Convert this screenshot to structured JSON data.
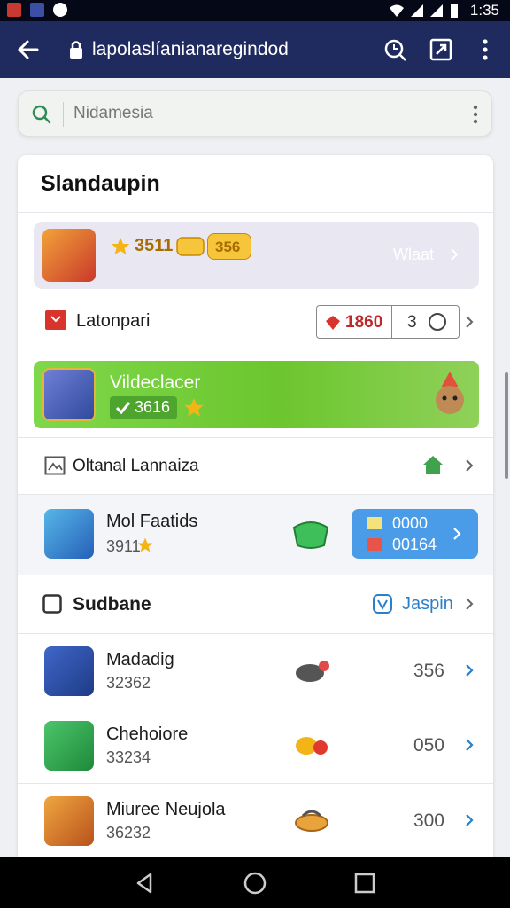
{
  "status_bar": {
    "time": "1:35"
  },
  "app_bar": {
    "url": "lapolaslíanianaregindod"
  },
  "search": {
    "placeholder": "Nidamesia"
  },
  "card": {
    "title": "Slandaupin",
    "featured": {
      "rating": "3511",
      "badge": "356",
      "action": "Wlaat"
    },
    "tokens_row": {
      "label": "Latonpari",
      "pill_value": "1860",
      "pill_count": "3"
    },
    "green_banner": {
      "title": "Vildeclacer",
      "chip": "3616"
    },
    "channel_row": {
      "label": "Oltanal Lannaiza"
    },
    "featured_game": {
      "name": "Mol Faatids",
      "score": "3911",
      "line1": "0000",
      "line2": "00164"
    },
    "section": {
      "title": "Sudbane",
      "link": "Jaspin"
    },
    "list": [
      {
        "name": "Madadig",
        "sub": "32362",
        "value": "356"
      },
      {
        "name": "Chehoiore",
        "sub": "33234",
        "value": "050"
      },
      {
        "name": "Miuree Neujola",
        "sub": "36232",
        "value": "300"
      }
    ]
  },
  "colors": {
    "app_bar": "#1f2a5e",
    "accent_blue": "#4a9ce8",
    "accent_green": "#6cc62e",
    "gold": "#f3b418"
  },
  "icons": [
    "back-arrow-icon",
    "lock-icon",
    "refresh-search-icon",
    "edit-icon",
    "more-vert-icon",
    "search-icon",
    "star-icon",
    "home-icon",
    "chevron-right-icon"
  ]
}
